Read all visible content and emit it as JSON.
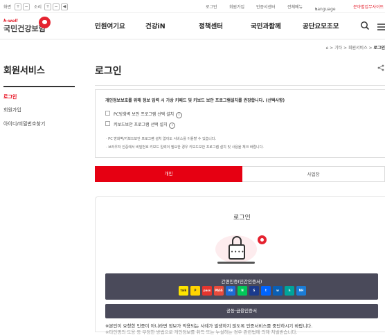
{
  "util_bar": {
    "screen_label": "화면",
    "sound_label": "소리",
    "plus": "+",
    "minus": "−",
    "links": [
      "로그인",
      "회원가입",
      "인증서센터",
      "전체메뉴"
    ],
    "language": "Language",
    "site_link": "분야별업무사이트"
  },
  "header": {
    "logo_sup": "h-well",
    "logo_text": "국민건강보험",
    "nav": [
      "민원여기요",
      "건강iN",
      "정책센터",
      "국민과함께",
      "공단요모조모"
    ]
  },
  "breadcrumb": [
    "기타",
    "회원서비스",
    "로그인"
  ],
  "sidebar": {
    "title": "회원서비스",
    "items": [
      "로그인",
      "회원가입",
      "아이디/비밀번호찾기"
    ]
  },
  "page": {
    "title": "로그인"
  },
  "notice": {
    "heading": "개인정보보호를 위해 정보 입력 시 가상 키패드 및 키보드 보안 프로그램설치를 권장합니다. (선택사항)",
    "options": [
      "PC방화벽 보안 프로그램 선택 설치",
      "키보드보안 프로그램 선택 설치"
    ],
    "bullets": [
      "· PC 방화벽/키보드보안 프로그램 설치 없이도 서비스를 이용할 수 있습니다.",
      "· 브라우저 인증에서 비밀번호 키보드 입력이 필요한 경우 키보드보안 프로그램 설치 및 사용을 체크 바랍니다."
    ]
  },
  "tabs": [
    "개인",
    "사업장"
  ],
  "login_panel": {
    "title": "로그인",
    "simple_auth_label": "간편인증(민간인증서)",
    "cert_icons": [
      {
        "name": "kakao",
        "label": "talk",
        "color": "#fee500",
        "text_color": "#3a1d1d"
      },
      {
        "name": "payco",
        "label": "P",
        "color": "#ffd400",
        "text_color": "#333333"
      },
      {
        "name": "samsung",
        "label": "pass",
        "color": "#e4352e",
        "text_color": "#ffffff"
      },
      {
        "name": "pass",
        "label": "PASS",
        "color": "#e84b3c",
        "text_color": "#ffffff"
      },
      {
        "name": "kb",
        "label": "KB",
        "color": "#1e6bd6",
        "text_color": "#ffffff"
      },
      {
        "name": "naver",
        "label": "N",
        "color": "#03c75a",
        "text_color": "#ffffff"
      },
      {
        "name": "shinhan",
        "label": "S",
        "color": "#1b3a8c",
        "text_color": "#ffffff"
      },
      {
        "name": "toss",
        "label": "t",
        "color": "#0064ff",
        "text_color": "#ffffff"
      },
      {
        "name": "woori",
        "label": "w",
        "color": "#0a5fb4",
        "text_color": "#ffffff"
      },
      {
        "name": "hana",
        "label": "h",
        "color": "#00a49a",
        "text_color": "#ffffff"
      },
      {
        "name": "nh",
        "label": "NH",
        "color": "#1b7cd6",
        "text_color": "#ffffff"
      }
    ],
    "joint_auth_label": "공동·금융인증서",
    "warning": "※본인이 요청한 인증이 아니라면 정보가 악용되는 사례가 발생하지 않도록 인증서비스를 중단하시기 바랍니다.",
    "warning2": "※타인명의 도용 등 부정한 방법으로 개인정보를 취득 또는 누설하는 경우 관련법에 의해 처벌받습니다."
  },
  "colors": {
    "accent": "#e60012",
    "button": "#4a4a5a"
  }
}
